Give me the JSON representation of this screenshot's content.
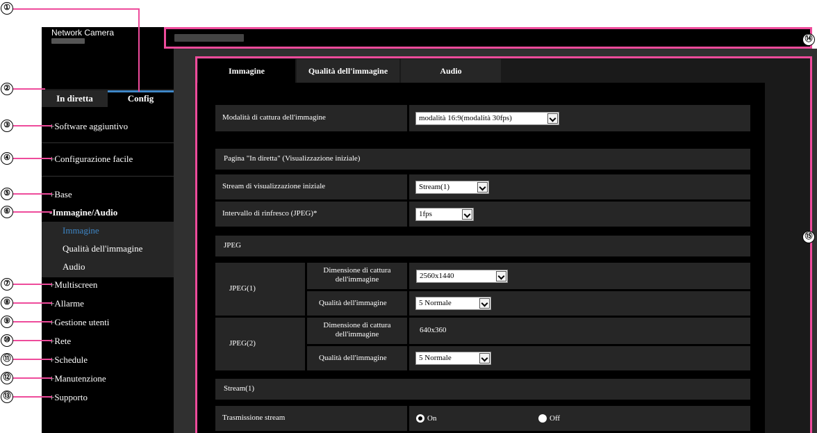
{
  "brand": {
    "title": "Network Camera"
  },
  "nav_tabs": {
    "live": "In diretta",
    "config": "Config"
  },
  "menu": {
    "items": [
      "+Software aggiuntivo",
      "+Configurazione facile",
      "+Base",
      "-Immagine/Audio",
      "+Multiscreen",
      "+Allarme",
      "+Gestione utenti",
      "+Rete",
      "+Schedule",
      "+Manutenzione",
      "+Supporto"
    ],
    "submenu": [
      "Immagine",
      "Qualità dell'immagine",
      "Audio"
    ],
    "active_submenu": "Immagine"
  },
  "content_tabs": [
    "Immagine",
    "Qualità dell'immagine",
    "Audio"
  ],
  "settings": {
    "capture_mode": {
      "label": "Modalità di cattura dell'immagine",
      "value": "modalità 16:9(modalità 30fps)"
    },
    "live_section": "Pagina \"In diretta\" (Visualizzazione iniziale)",
    "initial_stream": {
      "label": "Stream di visualizzazione iniziale",
      "value": "Stream(1)"
    },
    "refresh": {
      "label": "Intervallo di rinfresco (JPEG)*",
      "value": "1fps"
    },
    "jpeg_section": "JPEG",
    "jpeg1": {
      "name": "JPEG(1)",
      "size_label": "Dimensione di cattura dell'immagine",
      "size_value": "2560x1440",
      "quality_label": "Qualità dell'immagine",
      "quality_value": "5 Normale"
    },
    "jpeg2": {
      "name": "JPEG(2)",
      "size_label": "Dimensione di cattura dell'immagine",
      "size_value": "640x360",
      "quality_label": "Qualità dell'immagine",
      "quality_value": "5 Normale"
    },
    "stream_section": "Stream(1)",
    "transmission": {
      "label": "Trasmissione stream",
      "on": "On",
      "off": "Off",
      "selected": "On"
    }
  },
  "callouts": [
    "①",
    "②",
    "③",
    "④",
    "⑤",
    "⑥",
    "⑦",
    "⑧",
    "⑨",
    "⑩",
    "⑪",
    "⑫",
    "⑬",
    "⑭",
    "⑮"
  ],
  "colors": {
    "highlight": "#ee4b9b",
    "accent": "#3e86c6",
    "background": "#000000"
  }
}
